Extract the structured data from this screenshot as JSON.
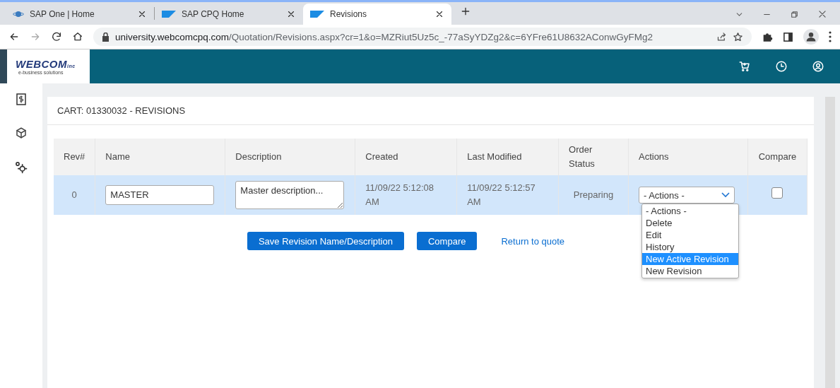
{
  "browser": {
    "tabs": [
      {
        "title": "SAP One | Home",
        "selected": false
      },
      {
        "title": "SAP CPQ Home",
        "selected": false
      },
      {
        "title": "Revisions",
        "selected": true
      }
    ],
    "url_host": "university.webcomcpq.com",
    "url_path": "/Quotation/Revisions.aspx?cr=1&o=MZRiut5Uz5c_-77aSyYDZg2&c=6YFre61U8632AConwGyFMg2"
  },
  "logo": {
    "name": "WEBCOM",
    "suffix": "inc",
    "tagline": "e-business solutions"
  },
  "page_title": "CART: 01330032 - REVISIONS",
  "table": {
    "columns": [
      "Rev#",
      "Name",
      "Description",
      "Created",
      "Last Modified",
      "Order Status",
      "Actions",
      "Compare"
    ],
    "rows": [
      {
        "rev": "0",
        "name": "MASTER",
        "description": "Master description...",
        "created": "11/09/22 5:12:08 AM",
        "modified": "11/09/22 5:12:57 AM",
        "status": "Preparing",
        "action": "- Actions -",
        "compare": false,
        "selected": true
      }
    ]
  },
  "actions_menu": {
    "expanded": true,
    "options": [
      {
        "label": "- Actions -",
        "selected": false
      },
      {
        "label": "Delete",
        "selected": false
      },
      {
        "label": "Edit",
        "selected": false
      },
      {
        "label": "History",
        "selected": false
      },
      {
        "label": "New Active Revision",
        "selected": true
      },
      {
        "label": "New Revision",
        "selected": false
      }
    ]
  },
  "buttons": [
    "Save Revision Name/Description",
    "Compare"
  ],
  "link": "Return to quote"
}
